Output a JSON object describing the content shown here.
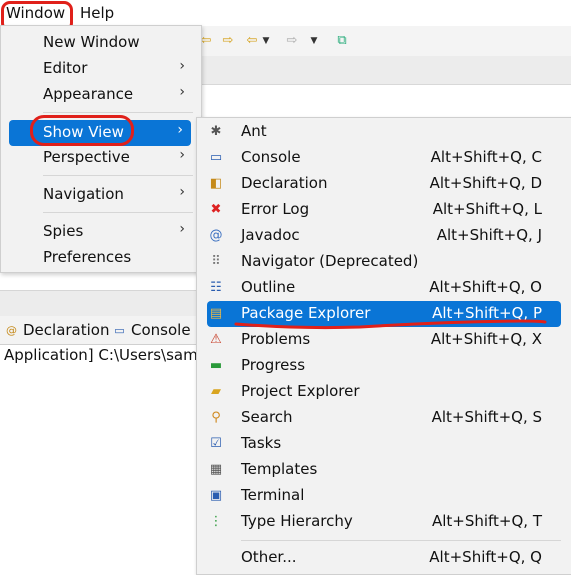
{
  "menubar": {
    "window_label": "Window",
    "help_label": "Help"
  },
  "background": {
    "tabs": [
      "Declaration",
      "Console"
    ],
    "console_text": "Application] C:\\Users\\sams"
  },
  "window_menu": {
    "items": [
      {
        "label": "New Window",
        "submenu": false
      },
      {
        "label": "Editor",
        "submenu": true
      },
      {
        "label": "Appearance",
        "submenu": true
      },
      {
        "label": "Show View",
        "submenu": true,
        "selected": true
      },
      {
        "label": "Perspective",
        "submenu": true
      },
      {
        "label": "Navigation",
        "submenu": true
      },
      {
        "label": "Spies",
        "submenu": true
      },
      {
        "label": "Preferences",
        "submenu": false
      }
    ],
    "arrow": "›"
  },
  "show_view_menu": {
    "items": [
      {
        "label": "Ant",
        "shortcut": "",
        "icon": "ant-icon"
      },
      {
        "label": "Console",
        "shortcut": "Alt+Shift+Q, C",
        "icon": "console-icon"
      },
      {
        "label": "Declaration",
        "shortcut": "Alt+Shift+Q, D",
        "icon": "declaration-icon"
      },
      {
        "label": "Error Log",
        "shortcut": "Alt+Shift+Q, L",
        "icon": "error-log-icon"
      },
      {
        "label": "Javadoc",
        "shortcut": "Alt+Shift+Q, J",
        "icon": "javadoc-icon"
      },
      {
        "label": "Navigator (Deprecated)",
        "shortcut": "",
        "icon": "navigator-icon"
      },
      {
        "label": "Outline",
        "shortcut": "Alt+Shift+Q, O",
        "icon": "outline-icon"
      },
      {
        "label": "Package Explorer",
        "shortcut": "Alt+Shift+Q, P",
        "icon": "package-explorer-icon",
        "selected": true
      },
      {
        "label": "Problems",
        "shortcut": "Alt+Shift+Q, X",
        "icon": "problems-icon"
      },
      {
        "label": "Progress",
        "shortcut": "",
        "icon": "progress-icon"
      },
      {
        "label": "Project Explorer",
        "shortcut": "",
        "icon": "project-explorer-icon"
      },
      {
        "label": "Search",
        "shortcut": "Alt+Shift+Q, S",
        "icon": "search-icon"
      },
      {
        "label": "Tasks",
        "shortcut": "",
        "icon": "tasks-icon"
      },
      {
        "label": "Templates",
        "shortcut": "",
        "icon": "templates-icon"
      },
      {
        "label": "Terminal",
        "shortcut": "",
        "icon": "terminal-icon"
      },
      {
        "label": "Type Hierarchy",
        "shortcut": "Alt+Shift+Q, T",
        "icon": "type-hierarchy-icon"
      },
      {
        "label": "Other...",
        "shortcut": "Alt+Shift+Q, Q",
        "icon": ""
      }
    ]
  },
  "colors": {
    "selection": "#0a75d6",
    "annotation": "#e0201a",
    "menu_bg": "#f2f2f2"
  }
}
